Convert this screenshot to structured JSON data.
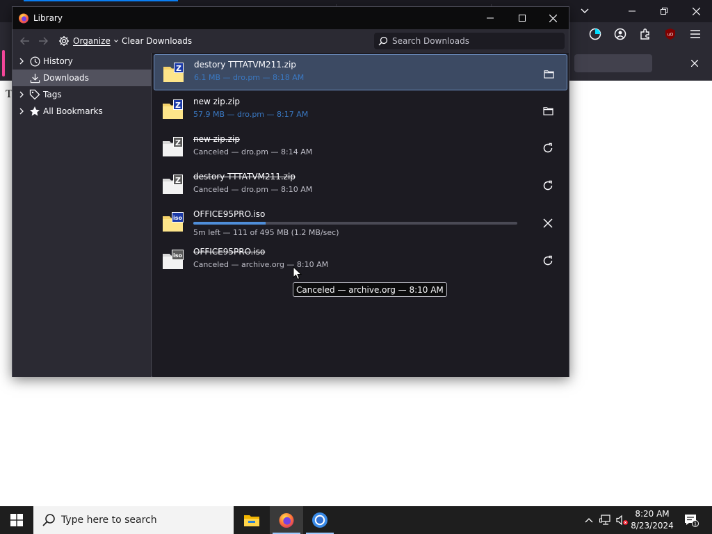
{
  "page": {
    "fragment_text": "T"
  },
  "browser": {
    "toolbar_icons": [
      "firefox-view-icon",
      "account-icon",
      "extensions-icon",
      "ublock-origin-icon",
      "menu-hamburger-icon"
    ],
    "notification": {
      "close_icon": "close-icon"
    }
  },
  "library": {
    "title": "Library",
    "window_controls": [
      "minimize-icon",
      "maximize-icon",
      "close-icon"
    ],
    "toolbar": {
      "organize_label": "Organize",
      "clear_downloads_label": "Clear Downloads",
      "search_placeholder": "Search Downloads"
    },
    "sidebar": {
      "items": [
        {
          "label": "History",
          "icon": "clock-icon",
          "has_twisty": true,
          "selected": false
        },
        {
          "label": "Downloads",
          "icon": "download-icon",
          "has_twisty": false,
          "selected": true
        },
        {
          "label": "Tags",
          "icon": "tag-icon",
          "has_twisty": true,
          "selected": false
        },
        {
          "label": "All Bookmarks",
          "icon": "star-icon",
          "has_twisty": true,
          "selected": false
        }
      ]
    },
    "downloads": [
      {
        "filename": "destory TTTATVM211.zip",
        "status": "6.1 MB — dro.pm — 8:18 AM",
        "state": "complete",
        "file_type": "zip",
        "action": "folder-icon",
        "selected": true
      },
      {
        "filename": "new zip.zip",
        "status": "57.9 MB — dro.pm — 8:17 AM",
        "state": "complete",
        "file_type": "zip",
        "action": "folder-icon",
        "selected": false
      },
      {
        "filename": "new zip.zip",
        "status": "Canceled — dro.pm — 8:14 AM",
        "state": "canceled",
        "file_type": "zip",
        "action": "retry-icon",
        "selected": false
      },
      {
        "filename": "destory TTTATVM211.zip",
        "status": "Canceled — dro.pm — 8:10 AM",
        "state": "canceled",
        "file_type": "zip",
        "action": "retry-icon",
        "selected": false
      },
      {
        "filename": "OFFICE95PRO.iso",
        "status": "5m left — 111 of 495 MB (1.2 MB/sec)",
        "state": "downloading",
        "progress": 0.224,
        "file_type": "iso",
        "action": "cancel-icon",
        "selected": false
      },
      {
        "filename": "OFFICE95PRO.iso",
        "status": "Canceled — archive.org — 8:10 AM",
        "state": "canceled",
        "file_type": "iso",
        "action": "retry-icon",
        "selected": false
      }
    ],
    "tooltip": "Canceled — archive.org — 8:10 AM"
  },
  "taskbar": {
    "search_placeholder": "Type here to search",
    "apps": [
      "file-explorer-icon",
      "firefox-icon",
      "chrome-icon"
    ],
    "time": "8:20 AM",
    "date": "8/23/2024",
    "notification_count": "1"
  },
  "colors": {
    "window_bg": "#1c1b22",
    "toolbar_bg": "#2b2a33",
    "selection_bg": "#3c4a63",
    "progress_fill": "#4f8ed9"
  }
}
